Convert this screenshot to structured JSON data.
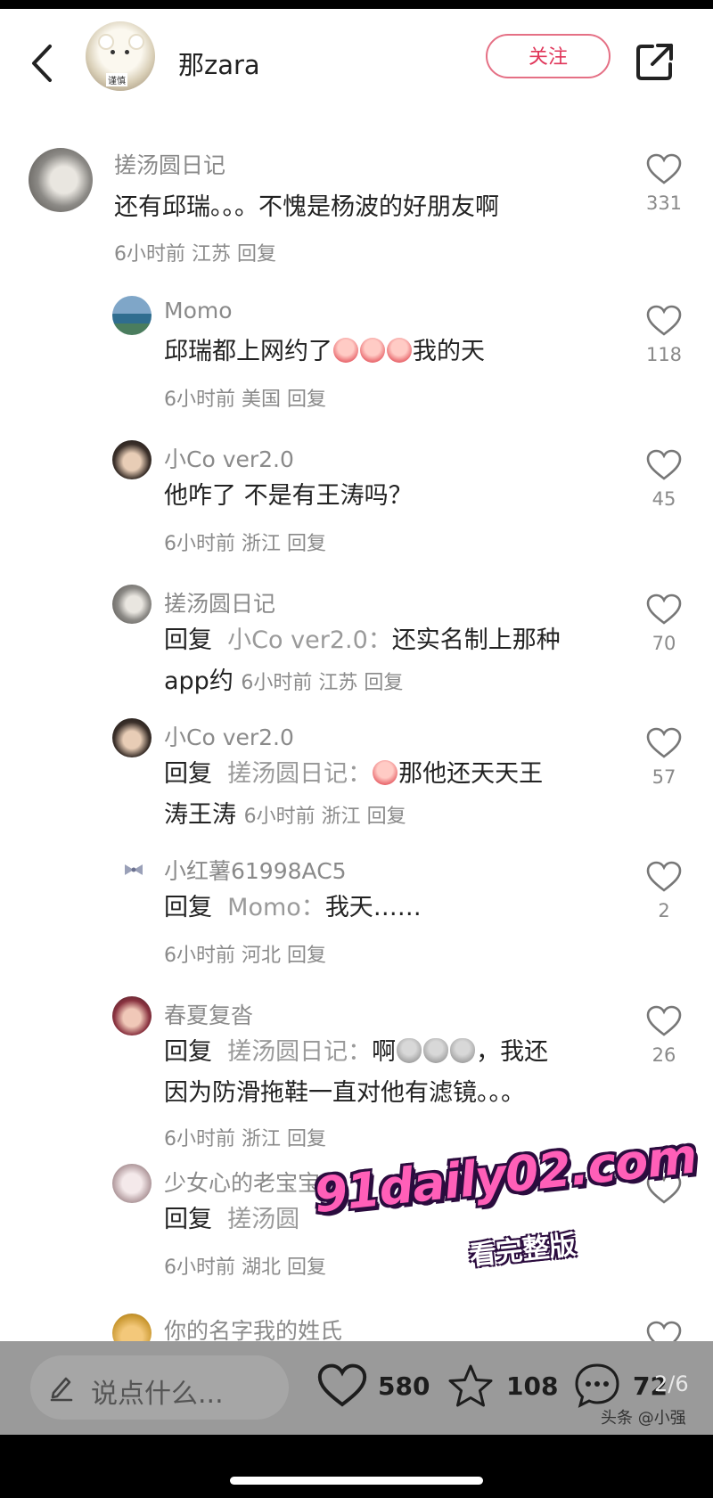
{
  "header": {
    "username": "那zara",
    "avatar_text": "谨慎",
    "follow_label": "关注"
  },
  "comments": [
    {
      "name": "搓汤圆日记",
      "text": "还有邱瑞。。。不愧是杨波的好朋友啊",
      "meta": "6小时前  江苏  回复",
      "likes": "331"
    },
    {
      "name": "Momo",
      "text_before": "邱瑞都上网约了",
      "text_after": "我的天",
      "meta": "6小时前  美国  回复",
      "likes": "118"
    },
    {
      "name": "小Co ver2.0",
      "text": "他咋了 不是有王涛吗？",
      "meta": "6小时前  浙江  回复",
      "likes": "45"
    },
    {
      "name": "搓汤圆日记",
      "reply_prefix": "回复",
      "reply_to": "小Co ver2.0：",
      "text_line1": "还实名制上那种",
      "text_line2": "app约",
      "meta": "6小时前  江苏  回复",
      "likes": "70"
    },
    {
      "name": "小Co ver2.0",
      "reply_prefix": "回复",
      "reply_to": "搓汤圆日记：",
      "text_line1": "那他还天天王",
      "text_line2": "涛王涛",
      "meta": "6小时前  浙江  回复",
      "likes": "57"
    },
    {
      "name": "小红薯61998AC5",
      "reply_prefix": "回复",
      "reply_to": "Momo：",
      "text": "我天……",
      "meta": "6小时前  河北  回复",
      "likes": "2"
    },
    {
      "name": "春夏复沓",
      "reply_prefix": "回复",
      "reply_to": "搓汤圆日记：",
      "text_line1_a": "啊",
      "text_line1_b": "，我还",
      "text_line2": "因为防滑拖鞋一直对他有滤镜。。。",
      "meta": "6小时前  浙江  回复",
      "likes": "26"
    },
    {
      "name": "少女心的老宝宝",
      "reply_prefix": "回复",
      "reply_to": "搓汤圆",
      "meta": "6小时前  湖北  回复"
    },
    {
      "name": "你的名字我的姓氏"
    }
  ],
  "watermark": {
    "main": "91daily02.com",
    "sub": "看完整版"
  },
  "bottom_bar": {
    "input_placeholder": "说点什么...",
    "likes": "580",
    "favorites": "108",
    "comments": "72",
    "page_indicator": "2/6",
    "source_tag": "头条 @小强"
  },
  "colors": {
    "accent": "#e0365a",
    "meta_gray": "#8a8a8a",
    "bottom_bar": "#9a9a9a"
  },
  "icons": [
    "back-arrow-icon",
    "share-icon",
    "heart-icon",
    "star-icon",
    "comment-icon",
    "pen-icon"
  ]
}
